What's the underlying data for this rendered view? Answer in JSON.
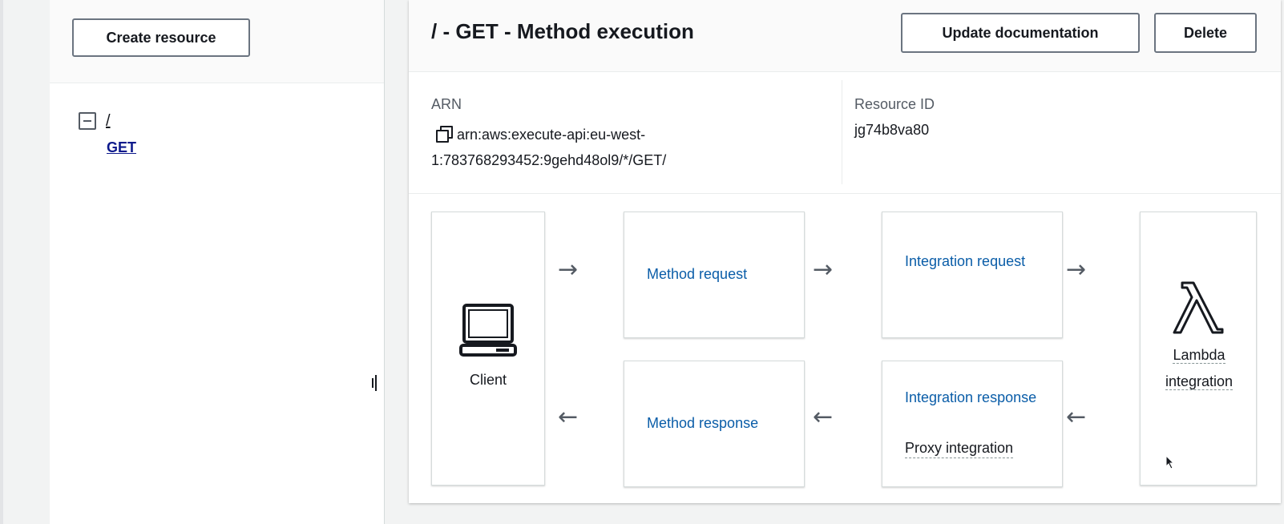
{
  "sidebar": {
    "create_button_label": "Create resource",
    "tree": {
      "root_label": "/",
      "method_label": "GET"
    }
  },
  "header": {
    "title": "/ - GET - Method execution",
    "update_button_label": "Update documentation",
    "delete_button_label": "Delete"
  },
  "details": {
    "arn_label": "ARN",
    "arn_value": "arn:aws:execute-api:eu-west-1:783768293452:9gehd48ol9/*/GET/",
    "resource_id_label": "Resource ID",
    "resource_id_value": "jg74b8va80"
  },
  "flow": {
    "client_label": "Client",
    "method_request_label": "Method request",
    "integration_request_label": "Integration request",
    "method_response_label": "Method response",
    "integration_response_label": "Integration response",
    "integration_response_detail": "Proxy integration",
    "lambda_label": "Lambda integration",
    "arrow_right": "→",
    "arrow_left": "←"
  },
  "colors": {
    "link": "#0a5da8",
    "text": "#16191f",
    "tree_link": "#0d1a8c"
  }
}
